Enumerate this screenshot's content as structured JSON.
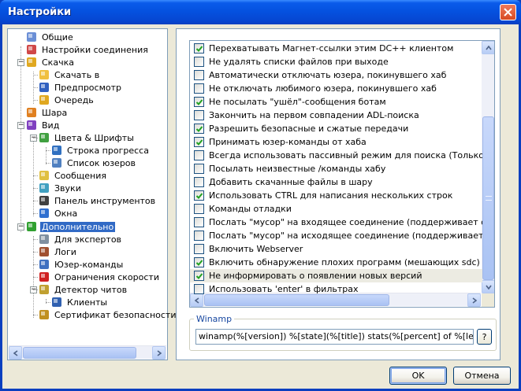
{
  "window": {
    "title": "Настройки"
  },
  "tree": {
    "items": [
      {
        "label": "Общие",
        "icon": "users-icon"
      },
      {
        "label": "Настройки соединения",
        "icon": "network-icon"
      },
      {
        "label": "Скачка",
        "icon": "download-icon"
      },
      {
        "label": "Скачать в",
        "icon": "folder-icon"
      },
      {
        "label": "Предпросмотр",
        "icon": "preview-icon"
      },
      {
        "label": "Очередь",
        "icon": "queue-icon"
      },
      {
        "label": "Шара",
        "icon": "share-icon"
      },
      {
        "label": "Вид",
        "icon": "appearance-icon"
      },
      {
        "label": "Цвета & Шрифты",
        "icon": "colors-icon"
      },
      {
        "label": "Строка прогресса",
        "icon": "progress-icon"
      },
      {
        "label": "Список юзеров",
        "icon": "userlist-icon"
      },
      {
        "label": "Сообщения",
        "icon": "messages-icon"
      },
      {
        "label": "Звуки",
        "icon": "sound-icon"
      },
      {
        "label": "Панель инструментов",
        "icon": "toolbar-icon"
      },
      {
        "label": "Окна",
        "icon": "windows-icon"
      },
      {
        "label": "Дополнительно",
        "icon": "advanced-icon"
      },
      {
        "label": "Для экспертов",
        "icon": "gear-icon"
      },
      {
        "label": "Логи",
        "icon": "logs-icon"
      },
      {
        "label": "Юзер-команды",
        "icon": "usercommands-icon"
      },
      {
        "label": "Ограничения скорости",
        "icon": "speed-limit-icon"
      },
      {
        "label": "Детектор читов",
        "icon": "lock-icon"
      },
      {
        "label": "Клиенты",
        "icon": "clients-icon"
      },
      {
        "label": "Сертификат безопасности",
        "icon": "certificate-icon"
      }
    ],
    "selected": "Дополнительно"
  },
  "options": [
    {
      "label": "Перехватывать Магнет-ссылки этим DC++ клиентом",
      "checked": true
    },
    {
      "label": "Не удалять списки файлов при выходе",
      "checked": false
    },
    {
      "label": "Автоматически отключать юзера, покинувшего хаб",
      "checked": false
    },
    {
      "label": "Не отключать любимого юзера, покинувшего хаб",
      "checked": false
    },
    {
      "label": "Не посылать \"ушёл\"-сообщения ботам",
      "checked": true
    },
    {
      "label": "Закончить на первом совпадении ADL-поиска",
      "checked": false
    },
    {
      "label": "Разрешить безопасные и сжатые передачи",
      "checked": true
    },
    {
      "label": "Принимать юзер-команды от хаба",
      "checked": true
    },
    {
      "label": "Всегда использовать пассивный режим для поиска (Только если вы",
      "checked": false
    },
    {
      "label": "Посылать неизвестные /команды хабу",
      "checked": false
    },
    {
      "label": "Добавить скачанные файлы в шару",
      "checked": false
    },
    {
      "label": "Использовать CTRL для написания нескольких строк",
      "checked": true
    },
    {
      "label": "Команды отладки",
      "checked": false
    },
    {
      "label": "Послать \"мусор\" на входящее соединение (поддерживает соедине",
      "checked": false
    },
    {
      "label": "Послать \"мусор\" на исходящее соединение (поддерживает соедине",
      "checked": false
    },
    {
      "label": "Включить Webserver",
      "checked": false
    },
    {
      "label": "Включить обнаружение плохих программ (мешающих sdc)",
      "checked": true
    },
    {
      "label": "Не информировать о появлении новых версий",
      "checked": true
    },
    {
      "label": "Использовать 'enter' в фильтрах",
      "checked": false
    }
  ],
  "winamp": {
    "group_label": "Winamp",
    "format_value": "winamp(%[version]) %[state](%[title]) stats(%[percent] of %[length]",
    "help_label": "?"
  },
  "buttons": {
    "ok": "OK",
    "cancel": "Отмена"
  },
  "colors": {
    "title_bar": "#0a5bea",
    "selection": "#316ac5",
    "dialog_bg": "#ece9d8"
  }
}
